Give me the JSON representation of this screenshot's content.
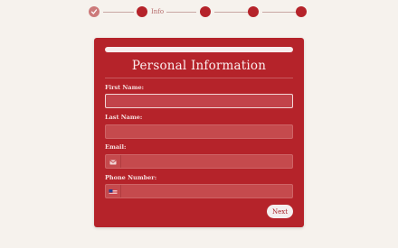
{
  "stepper": {
    "current_step_label": "Info",
    "steps": [
      {
        "state": "done"
      },
      {
        "state": "current"
      },
      {
        "state": "upcoming"
      },
      {
        "state": "upcoming"
      },
      {
        "state": "upcoming"
      }
    ]
  },
  "form": {
    "title": "Personal Information",
    "progress": 1.0,
    "fields": {
      "first_name": {
        "label": "First Name:",
        "value": ""
      },
      "last_name": {
        "label": "Last Name:",
        "value": ""
      },
      "email": {
        "label": "Email:",
        "value": "",
        "icon": "envelope-icon"
      },
      "phone": {
        "label": "Phone Number:",
        "value": "",
        "icon": "us-flag-icon"
      }
    },
    "next_label": "Next"
  },
  "colors": {
    "background": "#f6f2ed",
    "card": "#b5232a",
    "accent": "#b5232a"
  }
}
